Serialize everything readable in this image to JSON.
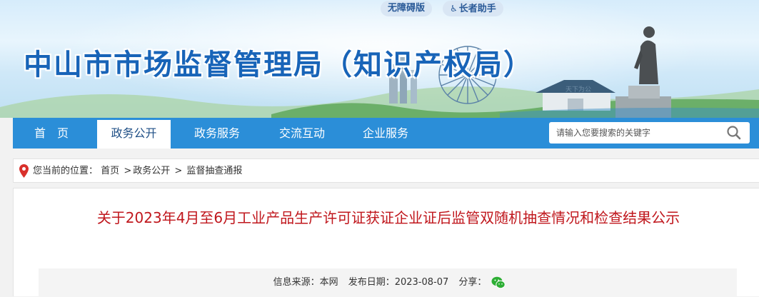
{
  "header": {
    "site_title": "中山市市场监督管理局（知识产权局）",
    "accessibility_label": "无障碍版",
    "elderly_label": "长者助手",
    "banner_calligraphy": "天下为公"
  },
  "nav": {
    "items": [
      {
        "label": "首　页"
      },
      {
        "label": "政务公开"
      },
      {
        "label": "政务服务"
      },
      {
        "label": "交流互动"
      },
      {
        "label": "企业服务"
      }
    ],
    "search_placeholder": "请输入您要搜索的关键字"
  },
  "breadcrumb": {
    "prefix": "您当前的位置：",
    "items": [
      "首页",
      "政务公开",
      "监督抽查通报"
    ]
  },
  "article": {
    "title": "关于2023年4月至6月工业产品生产许可证获证企业证后监管双随机抽查情况和检查结果公示",
    "source_label": "信息来源：本网",
    "date_label": "发布日期：2023-08-07",
    "share_label": "分享："
  },
  "colors": {
    "nav_bg": "#2b8ed8",
    "title_blue": "#1864b8",
    "article_title_red": "#c0171d"
  }
}
